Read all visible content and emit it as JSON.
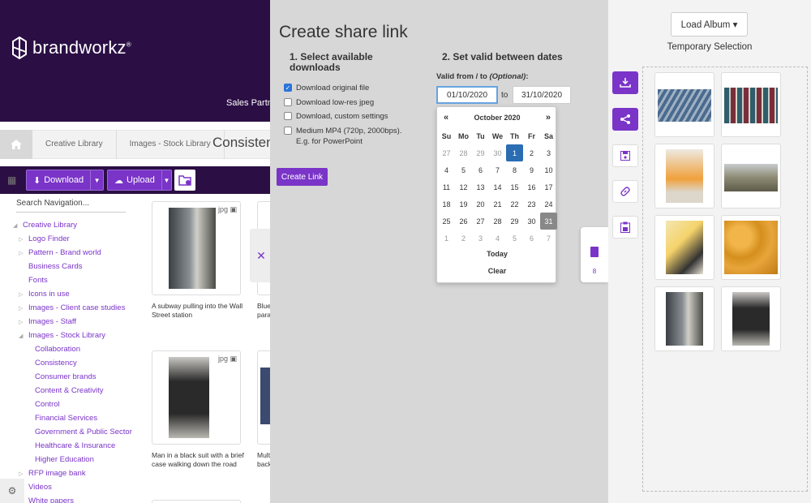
{
  "brand": {
    "logo_text": "brandworkz",
    "logo_mark": "®",
    "user_area": "Sales Partne"
  },
  "breadcrumb": {
    "items": [
      "Creative Library",
      "Images - Stock Library"
    ],
    "current": "Consistenc"
  },
  "toolbar": {
    "download_label": "Download",
    "upload_label": "Upload"
  },
  "search": {
    "placeholder": "Search Navigation..."
  },
  "navigation": {
    "items": [
      {
        "label": "Creative Library"
      },
      {
        "label": "Logo Finder"
      },
      {
        "label": "Pattern - Brand world"
      },
      {
        "label": "Business Cards"
      },
      {
        "label": "Fonts"
      },
      {
        "label": "Icons in use"
      },
      {
        "label": "Images - Client case studies"
      },
      {
        "label": "Images - Staff"
      },
      {
        "label": "Images - Stock Library"
      },
      {
        "label": "Collaboration"
      },
      {
        "label": "Consistency"
      },
      {
        "label": "Consumer brands"
      },
      {
        "label": "Content & Creativity"
      },
      {
        "label": "Control"
      },
      {
        "label": "Financial Services"
      },
      {
        "label": "Government & Public Sector"
      },
      {
        "label": "Healthcare & Insurance"
      },
      {
        "label": "Higher Education"
      },
      {
        "label": "RFP image bank"
      },
      {
        "label": "Videos"
      },
      {
        "label": "White papers"
      }
    ]
  },
  "assets": [
    {
      "type": "jpg",
      "caption": "A subway pulling into the Wall Street station"
    },
    {
      "type": "",
      "caption": "Blue para"
    },
    {
      "type": "jpg",
      "caption": "Man in a black suit with a brief case walking down the road"
    },
    {
      "type": "",
      "caption": "Mult back"
    }
  ],
  "share": {
    "title": "Create share link",
    "step1": "1. Select available downloads",
    "step2": "2. Set valid between dates",
    "options": [
      {
        "label": "Download original file",
        "checked": true
      },
      {
        "label": "Download low-res jpeg",
        "checked": false
      },
      {
        "label": "Download, custom settings",
        "checked": false
      },
      {
        "label": "Medium MP4 (720p, 2000bps). E.g. for PowerPoint",
        "checked": false
      }
    ],
    "create_label": "Create Link",
    "valid_label_prefix": "Valid from / to ",
    "valid_label_optional": "(Optional)",
    "valid_label_suffix": ":",
    "from_date": "01/10/2020",
    "to_word": "to",
    "to_date": "31/10/2020"
  },
  "calendar": {
    "prev": "«",
    "next": "»",
    "month": "October 2020",
    "weekdays": [
      "Su",
      "Mo",
      "Tu",
      "We",
      "Th",
      "Fr",
      "Sa"
    ],
    "weeks": [
      [
        "27",
        "28",
        "29",
        "30",
        "1",
        "2",
        "3"
      ],
      [
        "4",
        "5",
        "6",
        "7",
        "8",
        "9",
        "10"
      ],
      [
        "11",
        "12",
        "13",
        "14",
        "15",
        "16",
        "17"
      ],
      [
        "18",
        "19",
        "20",
        "21",
        "22",
        "23",
        "24"
      ],
      [
        "25",
        "26",
        "27",
        "28",
        "29",
        "30",
        "31"
      ],
      [
        "1",
        "2",
        "3",
        "4",
        "5",
        "6",
        "7"
      ]
    ],
    "selected_start": "1",
    "selected_end": "31",
    "today_label": "Today",
    "clear_label": "Clear"
  },
  "stack": {
    "count": "8"
  },
  "right_panel": {
    "load_album_label": "Load Album ▾",
    "title": "Temporary Selection"
  },
  "colors": {
    "brand_dark": "#2b0f44",
    "accent": "#7a34c8",
    "calendar_selected": "#2b6db3"
  }
}
